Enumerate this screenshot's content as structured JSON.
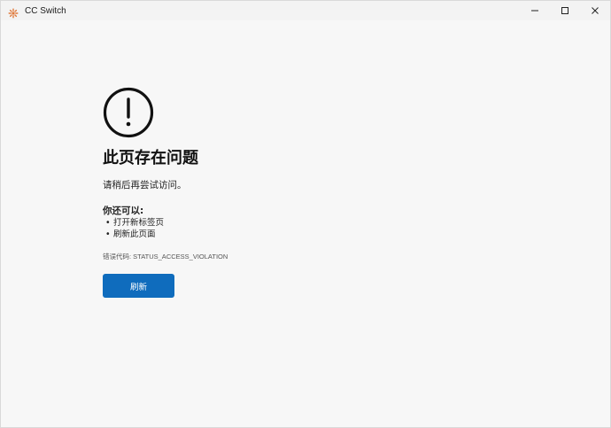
{
  "window": {
    "title": "CC Switch",
    "app_icon": "cc-switch-logo",
    "controls": [
      "minimize-icon",
      "maximize-icon",
      "close-icon"
    ]
  },
  "error_page": {
    "icon": "exclamation-circle-icon",
    "heading": "此页存在问题",
    "message": "请稍后再尝试访问。",
    "suggestions_title": "你还可以:",
    "suggestions": [
      "打开新标签页",
      "刷新此页面"
    ],
    "error_code_label": "错误代码: STATUS_ACCESS_VIOLATION",
    "refresh_label": "刷新"
  },
  "colors": {
    "background": "#f7f7f7",
    "titlebar": "#f3f3f3",
    "accent": "#0f6cbd",
    "app_icon": "#e07a3c"
  }
}
